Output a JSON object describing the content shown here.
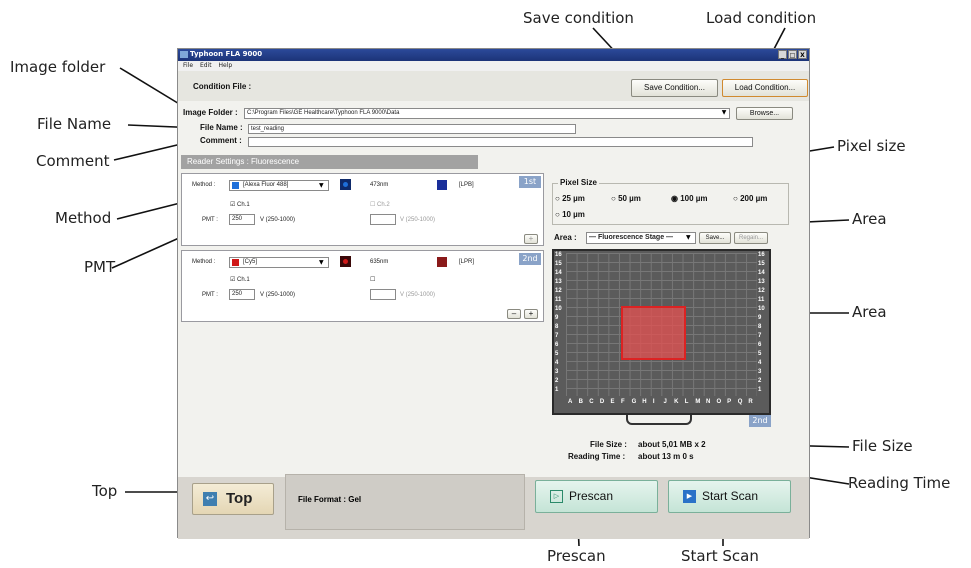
{
  "callouts": {
    "save_condition": "Save condition",
    "load_condition": "Load condition",
    "image_folder": "Image folder",
    "file_name": "File Name",
    "comment": "Comment",
    "method": "Method",
    "pmt": "PMT",
    "pixel_size": "Pixel size",
    "area_top": "Area",
    "area_mid": "Area",
    "file_size": "File Size",
    "reading_time": "Reading Time",
    "top": "Top",
    "prescan": "Prescan",
    "start_scan": "Start Scan"
  },
  "window": {
    "title": "Typhoon FLA 9000",
    "menu": [
      "File",
      "Edit",
      "Help"
    ],
    "controls": [
      "_",
      "□",
      "X"
    ]
  },
  "condition": {
    "label": "Condition File :",
    "save_btn": "Save Condition...",
    "load_btn": "Load Condition..."
  },
  "folder": {
    "label": "Image Folder :",
    "value": "C:\\Program Files\\GE Healthcare\\Typhoon FLA 9000\\Data",
    "browse": "Browse..."
  },
  "filename": {
    "label": "File Name :",
    "value": "test_reading"
  },
  "comment": {
    "label": "Comment :",
    "value": ""
  },
  "reader": {
    "header": "Reader Settings : Fluorescence"
  },
  "ch1": {
    "badge": "1st",
    "method_label": "Method :",
    "method": "[Alexa Fluor 488]",
    "wavelength": "473nm",
    "filter": "[LPB]",
    "chA": "Ch.1",
    "chB": "Ch.2",
    "pmt_label": "PMT :",
    "pmt": "250",
    "range_a": "V (250-1000)",
    "range_b": "V (250-1000)",
    "laser_color": "#1e6fd9",
    "filter_color": "#1a2f9a",
    "plus": "+"
  },
  "ch2": {
    "badge": "2nd",
    "method_label": "Method :",
    "method": "[Cy5]",
    "wavelength": "635nm",
    "filter": "[LPR]",
    "chA": "Ch.1",
    "pmt_label": "PMT :",
    "pmt": "250",
    "range_a": "V (250-1000)",
    "range_b": "V (250-1000)",
    "laser_color": "#d01818",
    "filter_color": "#8a1a1a",
    "minus": "–",
    "plus": "+"
  },
  "pixel": {
    "header": "Pixel Size",
    "options": [
      "25  µm",
      "50  µm",
      "100  µm",
      "200  µm",
      "10  µm"
    ],
    "selected": "100  µm"
  },
  "area": {
    "label": "Area :",
    "value": "— Fluorescence Stage —",
    "save": "Save...",
    "regain": "Regain...",
    "rows": [
      "16",
      "15",
      "14",
      "13",
      "12",
      "11",
      "10",
      "9",
      "8",
      "7",
      "6",
      "5",
      "4",
      "3",
      "2",
      "1"
    ],
    "cols": [
      "A",
      "B",
      "C",
      "D",
      "E",
      "F",
      "G",
      "H",
      "I",
      "J",
      "K",
      "L",
      "M",
      "N",
      "O",
      "P",
      "Q",
      "R"
    ],
    "badge": "2nd"
  },
  "info": {
    "file_size_label": "File Size :",
    "file_size": "about 5,01 MB x 2",
    "reading_time_label": "Reading Time :",
    "reading_time": "about 13 m 0 s"
  },
  "bottom": {
    "top": "Top",
    "file_format": "File Format : Gel",
    "prescan": "Prescan",
    "start_scan": "Start Scan"
  }
}
